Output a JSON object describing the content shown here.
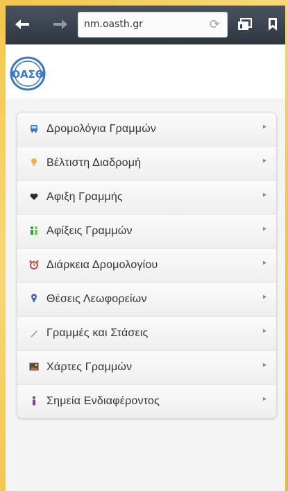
{
  "browser": {
    "url": "nm.oasth.gr",
    "icons": {
      "back": "arrow-left-icon",
      "forward": "arrow-right-icon",
      "reload": "reload-icon",
      "tabs": "tabs-icon",
      "bookmark": "bookmark-icon"
    }
  },
  "logo": {
    "text": "ΟΑΣΘ",
    "color": "#3a78c8"
  },
  "menu": {
    "items": [
      {
        "label": "Δρομολόγια Γραμμών",
        "icon": "bus-icon",
        "color": "#3b6fd0"
      },
      {
        "label": "Βέλτιστη Διαδρομή",
        "icon": "lightbulb-icon",
        "color": "#f2b23a"
      },
      {
        "label": "Αφιξη Γραμμής",
        "icon": "heart-icon",
        "color": "#2b2b2b"
      },
      {
        "label": "Αφίξεις Γραμμών",
        "icon": "people-icon",
        "color": "#2e9e3a"
      },
      {
        "label": "Διάρκεια Δρομολογίου",
        "icon": "alarm-clock-icon",
        "color": "#d9423c"
      },
      {
        "label": "Θέσεις Λεωφορείων",
        "icon": "map-pin-icon",
        "color": "#4466b8"
      },
      {
        "label": "Γραμμές και Στάσεις",
        "icon": "pencil-icon",
        "color": "#8b8b8b"
      },
      {
        "label": "Χάρτες Γραμμών",
        "icon": "picture-icon",
        "color": "#5a4a3a"
      },
      {
        "label": "Σημεία Ενδιαφέροντος",
        "icon": "person-icon",
        "color": "#7a3fa0"
      }
    ]
  }
}
